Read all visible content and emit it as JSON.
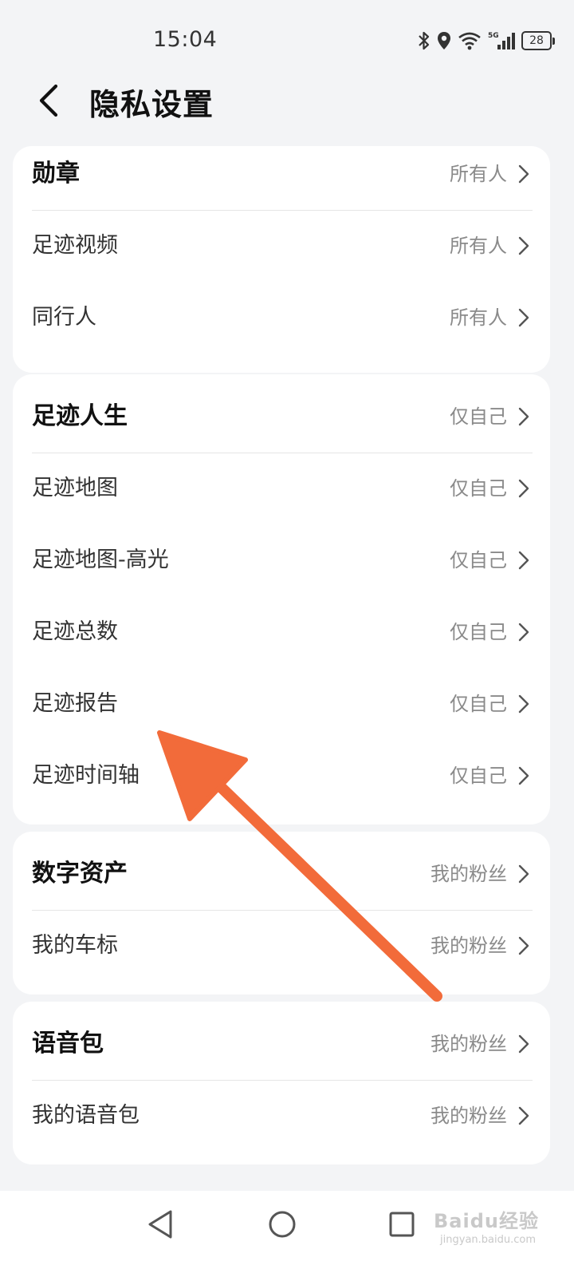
{
  "status_bar": {
    "time": "15:04",
    "battery": "28",
    "network": "5G"
  },
  "header": {
    "title": "隐私设置"
  },
  "groups": [
    {
      "rows": [
        {
          "label": "勋章",
          "value": "所有人",
          "bold": true
        },
        {
          "label": "足迹视频",
          "value": "所有人",
          "bold": false
        },
        {
          "label": "同行人",
          "value": "所有人",
          "bold": false
        }
      ]
    },
    {
      "rows": [
        {
          "label": "足迹人生",
          "value": "仅自己",
          "bold": true
        },
        {
          "label": "足迹地图",
          "value": "仅自己",
          "bold": false
        },
        {
          "label": "足迹地图-高光",
          "value": "仅自己",
          "bold": false
        },
        {
          "label": "足迹总数",
          "value": "仅自己",
          "bold": false
        },
        {
          "label": "足迹报告",
          "value": "仅自己",
          "bold": false
        },
        {
          "label": "足迹时间轴",
          "value": "仅自己",
          "bold": false
        }
      ]
    },
    {
      "rows": [
        {
          "label": "数字资产",
          "value": "我的粉丝",
          "bold": true
        },
        {
          "label": "我的车标",
          "value": "我的粉丝",
          "bold": false
        }
      ]
    },
    {
      "rows": [
        {
          "label": "语音包",
          "value": "我的粉丝",
          "bold": true
        },
        {
          "label": "我的语音包",
          "value": "我的粉丝",
          "bold": false
        }
      ]
    }
  ],
  "watermark": {
    "brand": "Baidu经验",
    "url": "jingyan.baidu.com"
  },
  "colors": {
    "background": "#f3f4f6",
    "card": "#ffffff",
    "arrow": "#f26b3a"
  }
}
